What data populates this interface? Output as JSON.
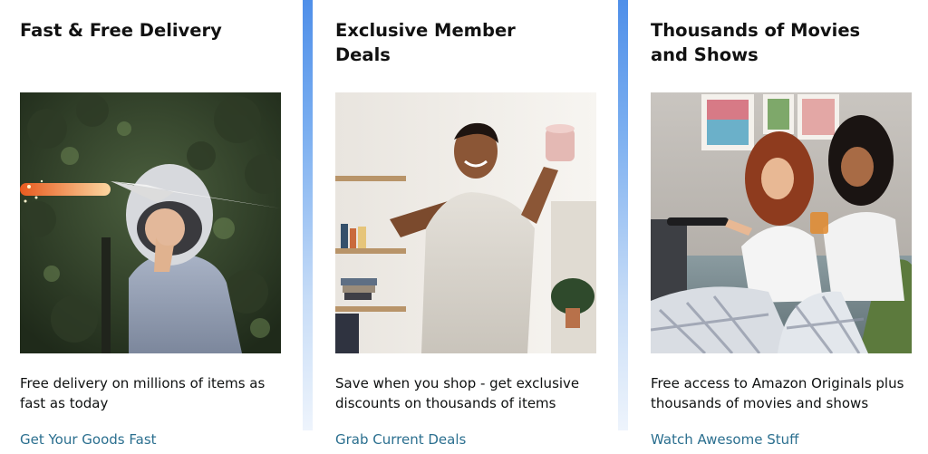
{
  "cards": [
    {
      "title": "Fast & Free Delivery",
      "image_subject": "child in space helmet with paper airplane",
      "description": "Free delivery on millions of items as fast as today",
      "link": "Get Your Goods Fast"
    },
    {
      "title": "Exclusive Member Deals",
      "image_subject": "smiling man holding up a mug",
      "description": "Save when you shop - get exclusive discounts on thousands of items",
      "link": "Grab Current Deals"
    },
    {
      "title": "Thousands of Movies and Shows",
      "image_subject": "two women watching TV on a couch",
      "description": "Free access to Amazon Originals plus thousands of movies and shows",
      "link": "Watch Awesome Stuff"
    }
  ],
  "colors": {
    "link": "#2b6f8f",
    "separator": "#4f8fe9",
    "title": "#111111"
  }
}
